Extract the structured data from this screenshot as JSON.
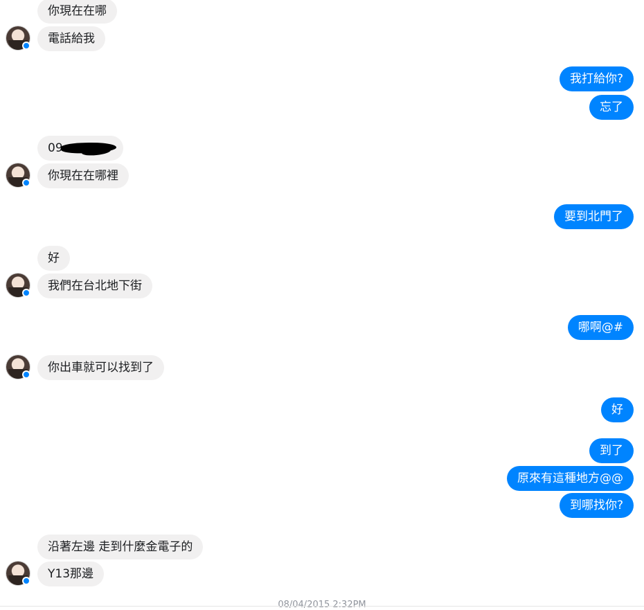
{
  "conversation": {
    "messages": [
      {
        "from": "them",
        "text": "你現在在哪"
      },
      {
        "from": "them",
        "text": "電話給我"
      },
      {
        "from": "me",
        "text": "我打給你?"
      },
      {
        "from": "me",
        "text": "忘了"
      },
      {
        "from": "them",
        "text": "09"
      },
      {
        "from": "them",
        "text": "你現在在哪裡"
      },
      {
        "from": "me",
        "text": "要到北門了"
      },
      {
        "from": "them",
        "text": "好"
      },
      {
        "from": "them",
        "text": "我們在台北地下街"
      },
      {
        "from": "me",
        "text": "哪啊@#"
      },
      {
        "from": "them",
        "text": "你出車就可以找到了"
      },
      {
        "from": "me",
        "text": "好"
      },
      {
        "from": "me",
        "text": "到了"
      },
      {
        "from": "me",
        "text": "原來有這種地方@@"
      },
      {
        "from": "me",
        "text": "到哪找你?"
      },
      {
        "from": "them",
        "text": "沿著左邊 走到什麼金電子的"
      },
      {
        "from": "them",
        "text": "Y13那邊"
      }
    ],
    "timestamp": "08/04/2015 2:32PM"
  },
  "colors": {
    "outgoing_bubble": "#0084ff",
    "incoming_bubble": "#f1f0f0",
    "incoming_text": "#1c1e21",
    "timestamp_text": "#90949c"
  },
  "icons": {
    "avatar": "contact-avatar",
    "messenger_badge": "messenger-badge-icon",
    "redaction": "redaction-mark"
  }
}
